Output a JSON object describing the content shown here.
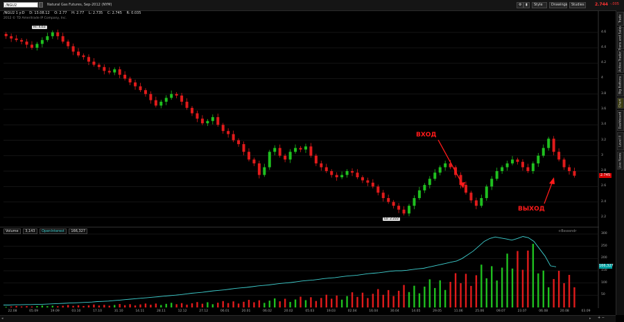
{
  "toolbar": {
    "symbol": "/NGU2",
    "description": "Natural Gas Futures, Sep-2012 (NYM)",
    "buttons": [
      "Style",
      "Drawings",
      "Studies"
    ],
    "last_price": "2.744",
    "last_change": "-.005"
  },
  "quote_line": {
    "symbol": "/NGU2 1 y:D",
    "date": "D: 13.08.12",
    "open": "O: 2.77",
    "high": "H: 2.77",
    "low": "L: 2.735",
    "close": "C: 2.745",
    "range": "R: 0.035"
  },
  "copyright": "2012 © TD Ameritrade IP Company, Inc.",
  "price_axis": [
    "4.6",
    "4.4",
    "4.2",
    "4",
    "3.8",
    "3.6",
    "3.4",
    "3.2",
    "3",
    "2.8",
    "2.6",
    "2.4",
    "2.2"
  ],
  "last_price_tag": "2.745",
  "volume_header": {
    "volume_label": "Volume",
    "volume_value": "3,143",
    "oi_label": "OpenInterest",
    "oi_value": "166,327"
  },
  "study_label": "+Bssssndr",
  "volume_axis": [
    "300",
    "250",
    "200",
    "150",
    "100",
    "50"
  ],
  "oi_tag": "166,327",
  "date_axis": [
    "22.08",
    "05.09",
    "19.09",
    "03.10",
    "17.10",
    "31.10",
    "14.11",
    "28.11",
    "12.12",
    "27.12",
    "06.01",
    "20.01",
    "06.02",
    "20.02",
    "05.03",
    "19.03",
    "02.04",
    "16.04",
    "30.04",
    "14.05",
    "29.05",
    "11.06",
    "25.06",
    "09.07",
    "23.07",
    "06.08",
    "20.08",
    "03.09"
  ],
  "annotations": {
    "entry": "ВХОД",
    "exit": "ВЫХОД",
    "high": "Hi: 4.63",
    "low": "Lo: 2.222"
  },
  "side_tabs": [
    "Trade",
    "Trans and Sales",
    "Active Trader",
    "Big Buttons",
    "Chart",
    "Dashboard",
    "Level II",
    "Live News"
  ],
  "zoom": "+ −",
  "colors": {
    "up": "#1fbf1f",
    "down": "#e01b1b",
    "oi": "#3fd0d0",
    "annotation": "#ff1a1a"
  },
  "chart_data": {
    "type": "candlestick",
    "price_range": [
      2.1,
      4.75
    ],
    "closes": [
      4.55,
      4.52,
      4.5,
      4.48,
      4.44,
      4.4,
      4.45,
      4.5,
      4.55,
      4.6,
      4.55,
      4.48,
      4.42,
      4.35,
      4.3,
      4.28,
      4.22,
      4.18,
      4.15,
      4.1,
      4.08,
      4.12,
      4.05,
      4.0,
      3.95,
      3.9,
      3.85,
      3.8,
      3.72,
      3.65,
      3.7,
      3.75,
      3.8,
      3.78,
      3.7,
      3.62,
      3.55,
      3.48,
      3.42,
      3.45,
      3.5,
      3.4,
      3.32,
      3.28,
      3.2,
      3.15,
      3.05,
      2.95,
      2.9,
      2.75,
      2.85,
      3.05,
      3.1,
      3.0,
      2.95,
      3.05,
      3.1,
      3.08,
      3.12,
      3.0,
      2.9,
      2.85,
      2.8,
      2.75,
      2.72,
      2.75,
      2.8,
      2.78,
      2.72,
      2.68,
      2.65,
      2.6,
      2.52,
      2.45,
      2.4,
      2.35,
      2.3,
      2.25,
      2.35,
      2.45,
      2.55,
      2.62,
      2.7,
      2.78,
      2.85,
      2.9,
      2.85,
      2.75,
      2.62,
      2.52,
      2.42,
      2.35,
      2.45,
      2.6,
      2.7,
      2.8,
      2.85,
      2.9,
      2.95,
      2.92,
      2.85,
      2.8,
      2.9,
      3.0,
      3.1,
      3.22,
      3.05,
      2.95,
      2.85,
      2.8,
      2.74
    ],
    "volume": [
      5,
      5,
      6,
      6,
      6,
      7,
      7,
      8,
      8,
      8,
      9,
      9,
      10,
      10,
      10,
      11,
      11,
      12,
      12,
      12,
      13,
      13,
      14,
      14,
      15,
      15,
      16,
      16,
      17,
      18,
      18,
      19,
      19,
      20,
      20,
      21,
      22,
      22,
      23,
      24,
      24,
      25,
      26,
      27,
      28,
      29,
      30,
      31,
      32,
      33,
      34,
      36,
      37,
      38,
      40,
      41,
      42,
      44,
      45,
      47,
      48,
      50,
      52,
      54,
      55,
      58,
      60,
      62,
      65,
      68,
      70,
      72,
      75,
      78,
      80,
      85,
      88,
      92,
      95,
      100,
      105,
      110,
      115,
      120,
      125,
      130,
      135,
      140,
      150,
      155,
      160,
      170,
      175,
      180,
      190,
      200,
      210,
      220,
      240,
      260,
      280,
      300,
      260,
      210,
      170,
      150,
      150,
      150,
      150,
      150,
      150
    ],
    "open_interest": [
      10,
      10,
      11,
      11,
      12,
      12,
      13,
      13,
      14,
      15,
      16,
      17,
      18,
      19,
      20,
      21,
      22,
      24,
      25,
      26,
      28,
      30,
      32,
      34,
      36,
      38,
      40,
      42,
      44,
      46,
      48,
      50,
      52,
      55,
      58,
      60,
      62,
      65,
      68,
      70,
      72,
      75,
      78,
      80,
      82,
      85,
      88,
      90,
      92,
      95,
      98,
      100,
      102,
      105,
      108,
      110,
      112,
      115,
      118,
      120,
      122,
      125,
      128,
      130,
      132,
      135,
      138,
      140,
      142,
      145,
      148,
      150,
      150,
      152,
      155,
      158,
      160,
      165,
      170,
      175,
      180,
      185,
      190,
      200,
      215,
      230,
      250,
      270,
      282,
      288,
      284,
      280,
      275,
      282,
      290,
      285,
      270,
      240,
      210,
      170,
      166
    ]
  }
}
